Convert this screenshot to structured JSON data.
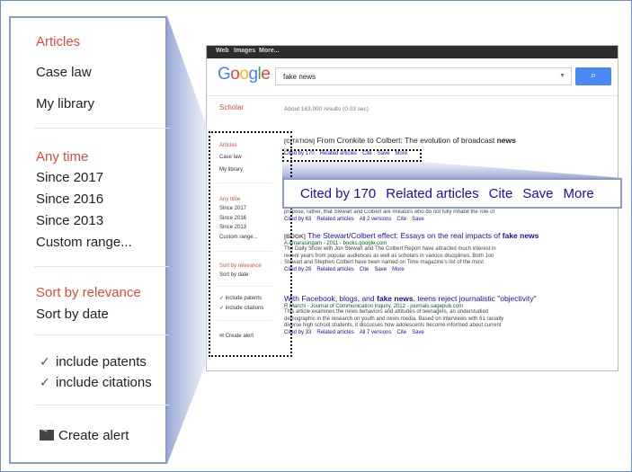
{
  "zoom_sidebar": {
    "types": [
      "Articles",
      "Case law",
      "My library"
    ],
    "time": [
      "Any time",
      "Since 2017",
      "Since 2016",
      "Since 2013",
      "Custom range..."
    ],
    "sort": [
      "Sort by relevance",
      "Sort by date"
    ],
    "checks": [
      "include patents",
      "include citations"
    ],
    "create_alert": "Create alert"
  },
  "zoom_links": [
    "Cited by 170",
    "Related articles",
    "Cite",
    "Save",
    "More"
  ],
  "screenshot": {
    "topbar": [
      "Web",
      "Images",
      "More..."
    ],
    "search_query": "fake news",
    "search_icon": "search-icon",
    "scholar_label": "Scholar",
    "about": "About 163,000 results (0.03 sec)",
    "sidebar": {
      "types": [
        "Articles",
        "Case law",
        "My library"
      ],
      "time": [
        "Any time",
        "Since 2017",
        "Since 2016",
        "Since 2013",
        "Custom range..."
      ],
      "sort": [
        "Sort by relevance",
        "Sort by date"
      ],
      "checks": [
        "include patents",
        "include citations"
      ],
      "create_alert": "Create alert"
    },
    "results": [
      {
        "tag": "[CITATION]",
        "title_pre": "From Cronkite to Colbert: The evolution of broadcast ",
        "title_bold": "news",
        "source": "...",
        "links": [
          "Cited by 170",
          "Related articles",
          "Cite",
          "Save",
          "More"
        ]
      },
      {
        "snippet": [
          "propose, rather, that Stewart and Colbert are imitators who do not fully inhabit the role of"
        ],
        "links": [
          "Cited by 63",
          "Related articles",
          "All 2 versions",
          "Cite",
          "Save"
        ]
      },
      {
        "tag": "[BOOK]",
        "title_pre": "The Stewart/Colbert effect: Essays on the real impacts of ",
        "title_bold": "fake news",
        "source": "A Amarasingam - 2011 - books.google.com",
        "snippet": [
          "The Daily Show with Jon Stewart and The Colbert Report have attracted much interest in",
          "recent years from popular audiences as well as scholars in various disciplines. Both Jon",
          "Stewart and Stephen Colbert have been named on Time magazine's list of the most"
        ],
        "links": [
          "Cited by 28",
          "Related articles",
          "Cite",
          "Save",
          "More"
        ]
      },
      {
        "title_pre": "With Facebook, blogs, and ",
        "title_bold": "fake news",
        "title_post": ", teens reject journalistic \"objectivity\"",
        "source": "R Marchi - Journal of Communication Inquiry, 2012 - journals.sagepub.com",
        "snippet": [
          "This article examines the news behaviors and attitudes of teenagers, an understudied",
          "demographic in the research on youth and news media. Based on interviews with 61 racially",
          "diverse high school students, it discusses how adolescents become informed about current"
        ],
        "links": [
          "Cited by 33",
          "Related articles",
          "All 7 versions",
          "Cite",
          "Save"
        ]
      }
    ]
  },
  "colors": {
    "accent_red": "#dd4b39",
    "link_blue": "#1a0dab",
    "frame_blue": "#8a9bc4",
    "search_blue": "#4a89f3"
  }
}
